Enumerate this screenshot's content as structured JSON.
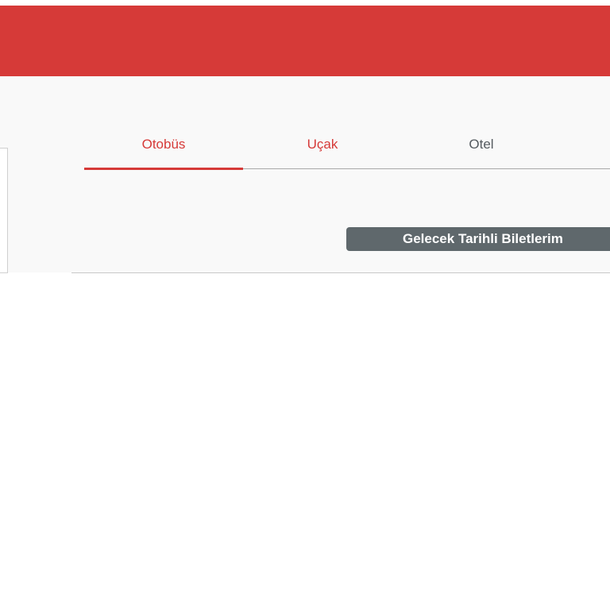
{
  "colors": {
    "brand": "#d63a38",
    "panel": "#f9f9f9",
    "tab_inactive": "#555b60",
    "button": "#5f686c"
  },
  "tabs": [
    {
      "label": "Otobüs",
      "active": true
    },
    {
      "label": "Uçak",
      "active": false
    },
    {
      "label": "Otel",
      "active": false
    }
  ],
  "actions": {
    "future_tickets_label": "Gelecek Tarihli Biletlerim"
  }
}
